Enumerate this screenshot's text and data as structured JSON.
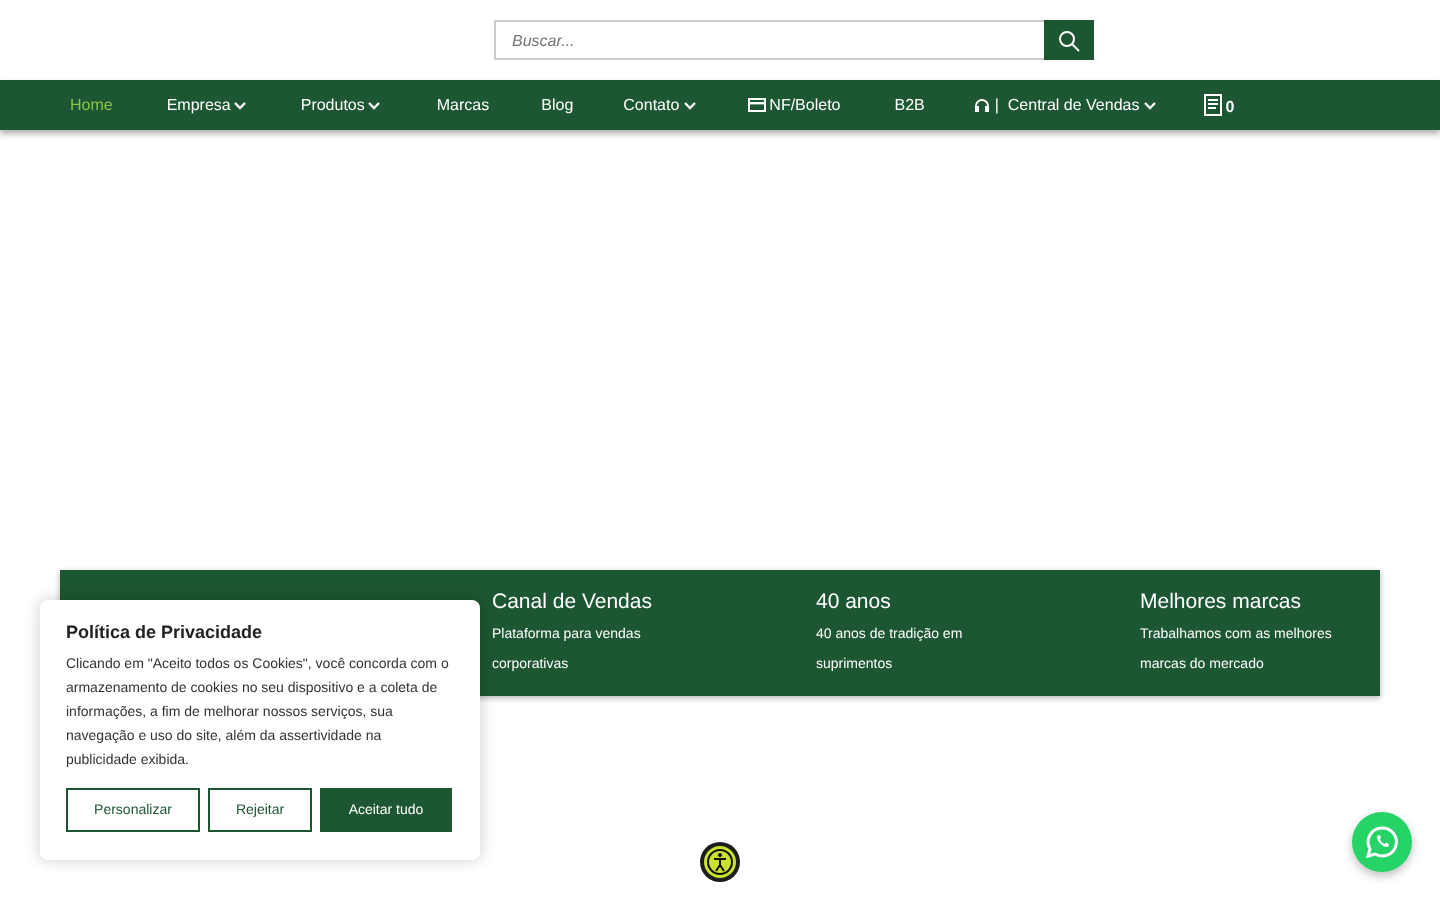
{
  "search": {
    "placeholder": "Buscar..."
  },
  "nav": [
    {
      "label": "Home",
      "selected": true,
      "dropdown": false
    },
    {
      "label": "Empresa",
      "selected": false,
      "dropdown": true
    },
    {
      "label": "Produtos",
      "selected": false,
      "dropdown": true
    },
    {
      "label": "Marcas",
      "selected": false,
      "dropdown": false
    },
    {
      "label": "Blog",
      "selected": false,
      "dropdown": false
    },
    {
      "label": "Contato",
      "selected": false,
      "dropdown": true
    },
    {
      "label": "NF/Boleto",
      "selected": false,
      "dropdown": false,
      "kind": "card"
    },
    {
      "label": "B2B",
      "selected": false,
      "dropdown": false
    },
    {
      "label": "|  Central de Vendas",
      "selected": false,
      "dropdown": true,
      "kind": "headset"
    }
  ],
  "cart": {
    "count": "0"
  },
  "features": [
    {
      "title": "Canal de Vendas",
      "text": "Plataforma para vendas corporativas"
    },
    {
      "title": "40 anos",
      "text": "40 anos de tradição em suprimentos"
    },
    {
      "title": "Melhores marcas",
      "text": "Trabalhamos com as melhores marcas do mercado"
    }
  ],
  "cookie": {
    "title": "Política de Privacidade",
    "text": "Clicando em \"Aceito todos os Cookies\", você concorda com o armazenamento de cookies no seu dispositivo e a coleta de informações, a fim de melhorar nossos serviços, sua navegação e uso do site, além da assertividade na publicidade exibida.",
    "buttons": [
      {
        "label": "Personalizar",
        "kind": "outline"
      },
      {
        "label": "Rejeitar",
        "kind": "outline"
      },
      {
        "label": "Aceitar tudo",
        "kind": "primary"
      }
    ]
  }
}
